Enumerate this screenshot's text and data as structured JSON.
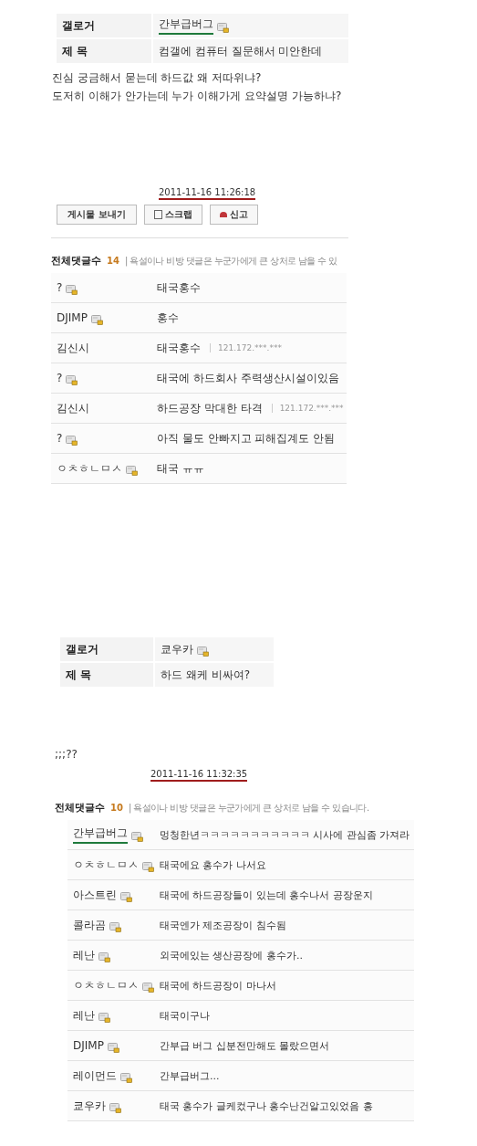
{
  "posts": [
    {
      "fields": [
        {
          "label": "갤로거",
          "value": "간부급버그",
          "member_icon": true,
          "underline": {
            "color": "#1f7a3c"
          }
        },
        {
          "label": "제 목",
          "value": "컴갤에 컴퓨터 질문해서 미안한데",
          "member_icon": false
        }
      ],
      "body": [
        "진심 궁금해서 묻는데 하드값 왜 저따위냐?",
        "도저히 이해가 안가는데 누가 이해가게 요약설명 가능하냐?"
      ],
      "date": {
        "text": "2011-11-16 11:26:18",
        "underline": {
          "color": "#a01c1c"
        }
      },
      "buttons": [
        {
          "label": "게시물 보내기",
          "kind": "plain"
        },
        {
          "label": "스크랩",
          "kind": "scrap"
        },
        {
          "label": "신고",
          "kind": "report"
        }
      ],
      "comments": {
        "label": "전체댓글수",
        "count": "14",
        "notice": "| 욕설이나 비방 댓글은 누군가에게 큰 상처로 남을 수 있",
        "rows": [
          {
            "author": "?",
            "member_icon": true,
            "text": "태국홍수"
          },
          {
            "author": "DJIMP",
            "member_icon": true,
            "text": "홍수"
          },
          {
            "author": "김신시",
            "member_icon": false,
            "text": "태국홍수",
            "ip": "121.172.***.***"
          },
          {
            "author": "?",
            "member_icon": true,
            "text": "태국에 하드회사 주력생산시설이있음"
          },
          {
            "author": "김신시",
            "member_icon": false,
            "text": "하드공장 막대한 타격",
            "ip": "121.172.***.***"
          },
          {
            "author": "?",
            "member_icon": true,
            "text": "아직 물도 안빠지고 피해집계도 안됨"
          },
          {
            "author": "ㅇㅊㅎㄴㅁㅅ",
            "member_icon": true,
            "text": "태국 ㅠㅠ"
          }
        ]
      }
    },
    {
      "fields": [
        {
          "label": "갤로거",
          "value": "쿄우카",
          "member_icon": true
        },
        {
          "label": "제 목",
          "value": "하드 왜케 비싸여?",
          "member_icon": false
        }
      ],
      "body": [
        ";;;??"
      ],
      "date": {
        "text": "2011-11-16 11:32:35",
        "underline": {
          "color": "#a01c1c"
        }
      },
      "comments": {
        "label": "전체댓글수",
        "count": "10",
        "notice": "| 욕설이나 비방 댓글은 누군가에게 큰 상처로 남을 수 있습니다.",
        "rows": [
          {
            "author": "간부급버그",
            "member_icon": true,
            "text": "멍청한년ㅋㅋㅋㅋㅋㅋㅋㅋㅋㅋㅋ 시사에 관심좀 가져라",
            "underline": {
              "color": "#1f7a3c"
            }
          },
          {
            "author": "ㅇㅊㅎㄴㅁㅅ",
            "member_icon": true,
            "text": "태국에요 홍수가 나서요"
          },
          {
            "author": "아스트린",
            "member_icon": true,
            "text": "태국에 하드공장들이 있는데 홍수나서 공장운지"
          },
          {
            "author": "콜라곰",
            "member_icon": true,
            "text": "태국엔가 제조공장이 침수됨"
          },
          {
            "author": "레난",
            "member_icon": true,
            "text": "외국에있는 생산공장에 홍수가.."
          },
          {
            "author": "ㅇㅊㅎㄴㅁㅅ",
            "member_icon": true,
            "text": "태국에 하드공장이 마나서"
          },
          {
            "author": "레난",
            "member_icon": true,
            "text": "태국이구나"
          },
          {
            "author": "DJIMP",
            "member_icon": true,
            "text": "간부급 버그 십분전만해도 몰랐으면서"
          },
          {
            "author": "레이먼드",
            "member_icon": true,
            "text": "간부급버그..."
          },
          {
            "author": "쿄우카",
            "member_icon": true,
            "text": "태국 홍수가 글케컸구나 홍수난건알고있었음 흥"
          }
        ]
      }
    }
  ]
}
